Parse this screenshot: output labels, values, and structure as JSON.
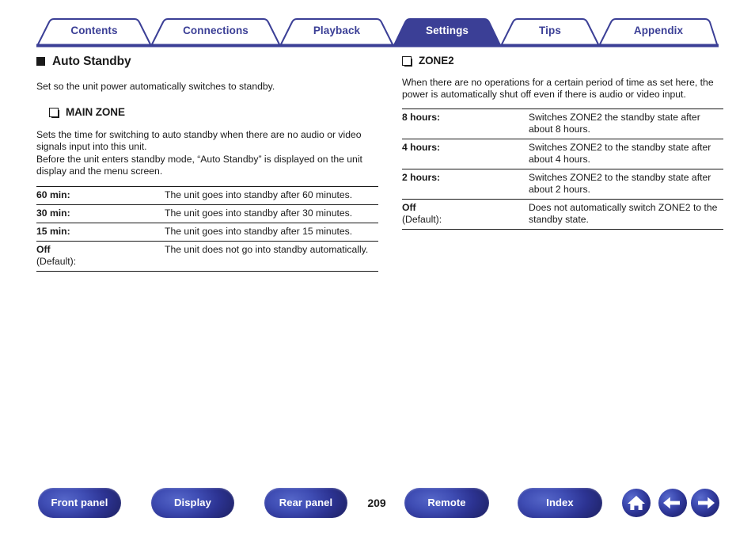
{
  "tabs": [
    {
      "label": "Contents",
      "active": false
    },
    {
      "label": "Connections",
      "active": false
    },
    {
      "label": "Playback",
      "active": false
    },
    {
      "label": "Settings",
      "active": true
    },
    {
      "label": "Tips",
      "active": false
    },
    {
      "label": "Appendix",
      "active": false
    }
  ],
  "colors": {
    "accent_blue": "#3b3f96",
    "active_tab_fill": "#3b3f96",
    "text": "#1a1a1a"
  },
  "left": {
    "heading": "Auto Standby",
    "intro": "Set so the unit power automatically switches to standby.",
    "subheading": "MAIN ZONE",
    "paragraph1": "Sets the time for switching to auto standby when there are no audio or video signals input into this unit.",
    "paragraph2": "Before the unit enters standby mode, “Auto Standby” is displayed on the unit display and the menu screen.",
    "table": [
      {
        "key": "60 min:",
        "default_label": "",
        "value": "The unit goes into standby after 60 minutes."
      },
      {
        "key": "30 min:",
        "default_label": "",
        "value": "The unit goes into standby after 30 minutes."
      },
      {
        "key": "15 min:",
        "default_label": "",
        "value": "The unit goes into standby after 15 minutes."
      },
      {
        "key": "Off",
        "default_label": "(Default):",
        "value": "The unit does not go into standby automatically."
      }
    ]
  },
  "right": {
    "subheading": "ZONE2",
    "paragraph1": "When there are no operations for a certain period of time as set here, the power is automatically shut off even if there is audio or video input.",
    "table": [
      {
        "key": "8 hours:",
        "default_label": "",
        "value": "Switches ZONE2 the standby state after about 8 hours."
      },
      {
        "key": "4 hours:",
        "default_label": "",
        "value": "Switches ZONE2 to the standby state after about 4 hours."
      },
      {
        "key": "2 hours:",
        "default_label": "",
        "value": "Switches ZONE2 to the standby state after about 2 hours."
      },
      {
        "key": "Off",
        "default_label": "(Default):",
        "value": "Does not automatically switch ZONE2 to the standby state."
      }
    ]
  },
  "footer": {
    "buttons": [
      {
        "label": "Front panel"
      },
      {
        "label": "Display"
      },
      {
        "label": "Rear panel"
      },
      {
        "label": "Remote"
      },
      {
        "label": "Index"
      }
    ],
    "page_number": "209",
    "icons": [
      {
        "name": "home-icon"
      },
      {
        "name": "arrow-left-icon"
      },
      {
        "name": "arrow-right-icon"
      }
    ]
  }
}
